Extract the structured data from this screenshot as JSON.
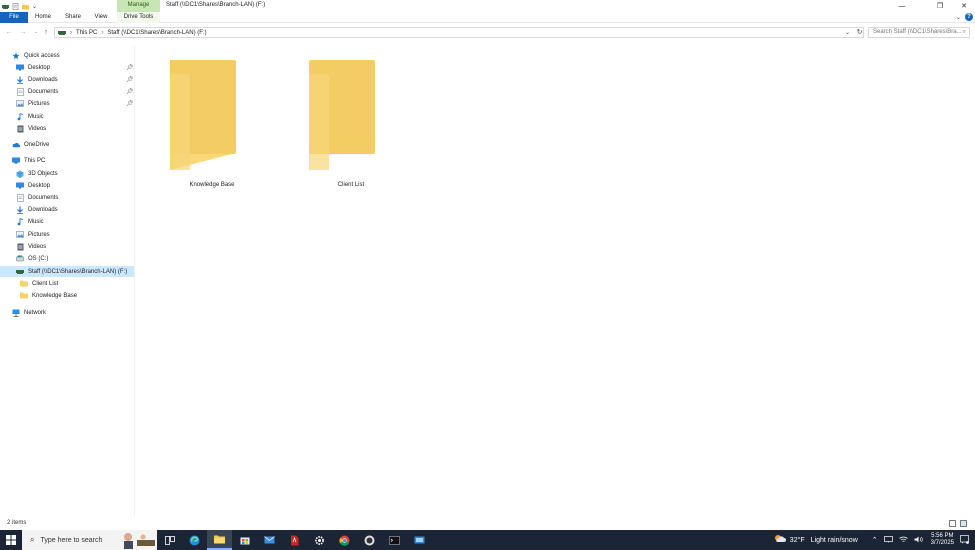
{
  "window": {
    "title": "Staff (\\\\DC1\\Shares\\Branch-LAN) (F:)",
    "manage_label": "Manage"
  },
  "ribbon": {
    "tabs": [
      {
        "label": "File"
      },
      {
        "label": "Home"
      },
      {
        "label": "Share"
      },
      {
        "label": "View"
      },
      {
        "label": "Drive Tools"
      }
    ]
  },
  "address": {
    "crumbs": [
      "This PC",
      "Staff (\\\\DC1\\Shares\\Branch-LAN) (F:)"
    ],
    "search_placeholder": "Search Staff (\\\\DC1\\Shares\\Bra..."
  },
  "nav": {
    "quick_access": "Quick access",
    "quick_items": [
      {
        "label": "Desktop",
        "icon": "desktop-icon",
        "pinned": true
      },
      {
        "label": "Downloads",
        "icon": "download-icon",
        "pinned": true
      },
      {
        "label": "Documents",
        "icon": "documents-icon",
        "pinned": true
      },
      {
        "label": "Pictures",
        "icon": "pictures-icon",
        "pinned": true
      },
      {
        "label": "Music",
        "icon": "music-icon",
        "pinned": false
      },
      {
        "label": "Videos",
        "icon": "videos-icon",
        "pinned": false
      }
    ],
    "onedrive": "OneDrive",
    "this_pc": "This PC",
    "pc_items": [
      {
        "label": "3D Objects",
        "icon": "3d-objects-icon"
      },
      {
        "label": "Desktop",
        "icon": "desktop-icon"
      },
      {
        "label": "Documents",
        "icon": "documents-icon"
      },
      {
        "label": "Downloads",
        "icon": "download-icon"
      },
      {
        "label": "Music",
        "icon": "music-icon"
      },
      {
        "label": "Pictures",
        "icon": "pictures-icon"
      },
      {
        "label": "Videos",
        "icon": "videos-icon"
      },
      {
        "label": "OS (C:)",
        "icon": "drive-icon"
      }
    ],
    "network_drive": "Staff (\\\\DC1\\Shares\\Branch-LAN) (F:)",
    "drive_children": [
      {
        "label": "Client List"
      },
      {
        "label": "Knowledge Base"
      }
    ],
    "network": "Network"
  },
  "content": {
    "folders": [
      {
        "label": "Knowledge Base"
      },
      {
        "label": "Client List"
      }
    ]
  },
  "status": {
    "item_count": "2 items"
  },
  "taskbar": {
    "search_placeholder": "Type here to search",
    "weather_temp": "32°F",
    "weather_desc": "Light rain/snow",
    "time": "5:56 PM",
    "date": "3/7/2025"
  },
  "colors": {
    "accent": "#1565c0",
    "selection": "#cce8ff",
    "manage_tab": "#c7e6b4",
    "folder": "#f5d26b",
    "taskbar": "#1c2535"
  }
}
